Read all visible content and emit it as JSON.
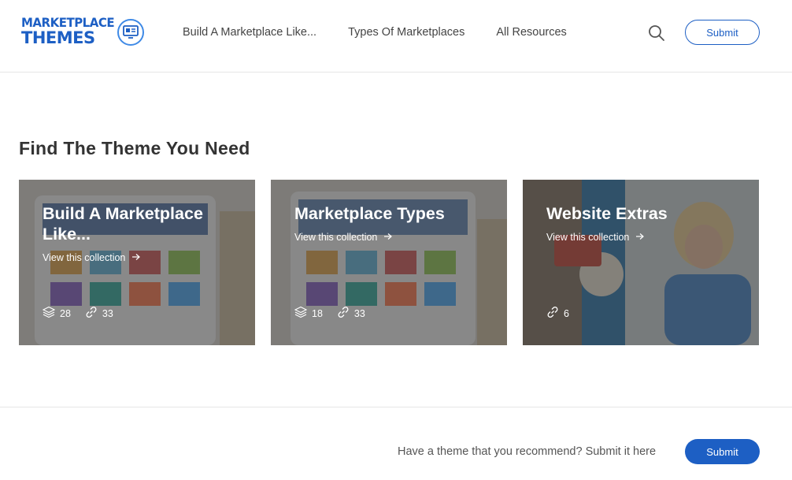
{
  "header": {
    "logo": {
      "line1": "MARKETPLACE",
      "line2": "THEMES"
    },
    "nav": [
      {
        "label": "Build A Marketplace Like..."
      },
      {
        "label": "Types Of Marketplaces"
      },
      {
        "label": "All Resources"
      }
    ],
    "submit_label": "Submit"
  },
  "main": {
    "title": "Find The Theme You Need",
    "cards": [
      {
        "title": "Build A Marketplace Like...",
        "link": "View this collection",
        "stats": [
          {
            "icon": "layers-icon",
            "value": "28"
          },
          {
            "icon": "link-icon",
            "value": "33"
          }
        ]
      },
      {
        "title": "Marketplace Types",
        "link": "View this collection",
        "stats": [
          {
            "icon": "layers-icon",
            "value": "18"
          },
          {
            "icon": "link-icon",
            "value": "33"
          }
        ]
      },
      {
        "title": "Website Extras",
        "link": "View this collection",
        "stats": [
          {
            "icon": "link-icon",
            "value": "6"
          }
        ]
      }
    ]
  },
  "footer": {
    "text": "Have a theme that you recommend? Submit it here",
    "submit_label": "Submit"
  },
  "colors": {
    "brand": "#1d5fc4",
    "text": "#333333"
  }
}
